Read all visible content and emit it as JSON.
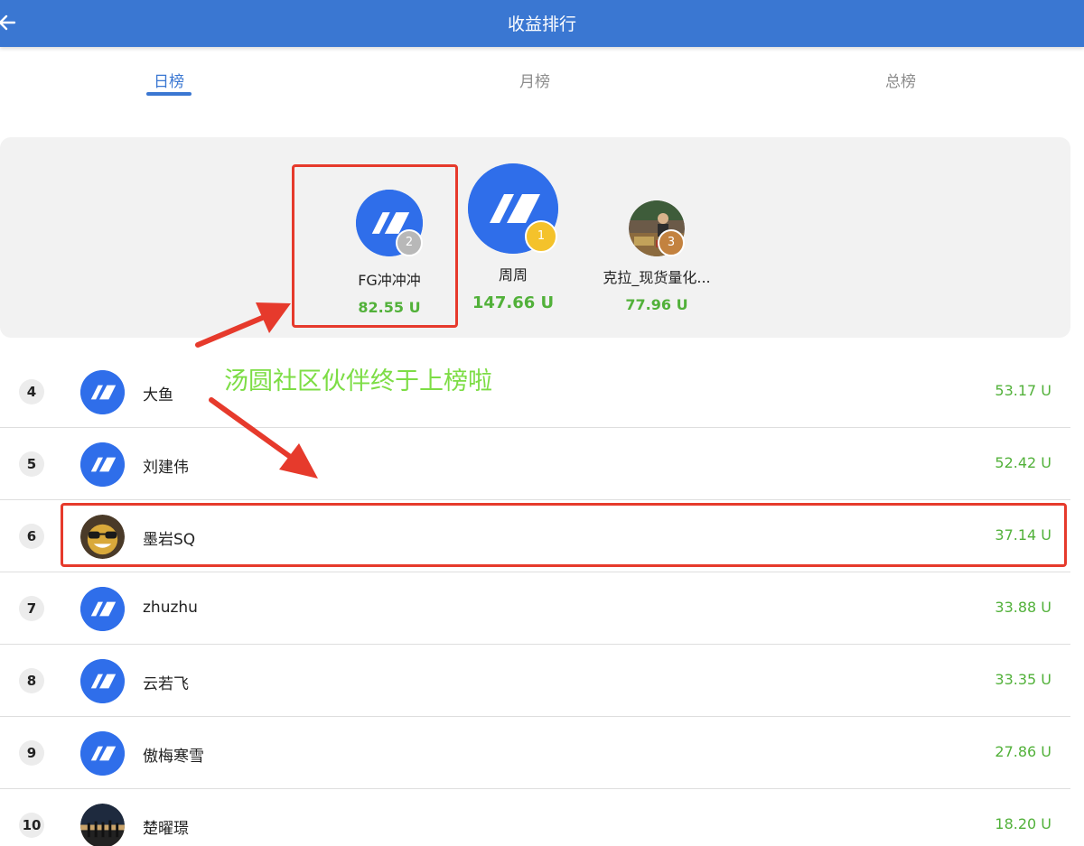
{
  "header": {
    "title": "收益排行",
    "back_icon": "arrow-left-icon"
  },
  "tabs": [
    {
      "label": "日榜",
      "active": true
    },
    {
      "label": "月榜",
      "active": false
    },
    {
      "label": "总榜",
      "active": false
    }
  ],
  "podium": {
    "first": {
      "rank": "1",
      "name": "周周",
      "value": "147.66 U",
      "avatar": "app-logo"
    },
    "second": {
      "rank": "2",
      "name": "FG冲冲冲",
      "value": "82.55 U",
      "avatar": "app-logo"
    },
    "third": {
      "rank": "3",
      "name": "克拉_现货量化...",
      "value": "77.96 U",
      "avatar": "photo"
    }
  },
  "list": [
    {
      "rank": "4",
      "name": "大鱼",
      "value": "53.17 U",
      "avatar": "app-logo"
    },
    {
      "rank": "5",
      "name": "刘建伟",
      "value": "52.42 U",
      "avatar": "app-logo"
    },
    {
      "rank": "6",
      "name": "墨岩SQ",
      "value": "37.14 U",
      "avatar": "photo-smiley"
    },
    {
      "rank": "7",
      "name": "zhuzhu",
      "value": "33.88 U",
      "avatar": "app-logo"
    },
    {
      "rank": "8",
      "name": "云若飞",
      "value": "33.35 U",
      "avatar": "app-logo"
    },
    {
      "rank": "9",
      "name": "傲梅寒雪",
      "value": "27.86 U",
      "avatar": "app-logo"
    },
    {
      "rank": "10",
      "name": "楚曜璟",
      "value": "18.20 U",
      "avatar": "photo-silhouette"
    }
  ],
  "annotation": {
    "text": "汤圆社区伙伴终于上榜啦"
  },
  "colors": {
    "accent": "#3a77d2",
    "value_green": "#52b13a",
    "badge_gold": "#f4c22b",
    "badge_silver": "#b8b8b8",
    "badge_bronze": "#c3823f",
    "annotation_red": "#e63a2c",
    "annotation_green": "#7ddd45"
  }
}
